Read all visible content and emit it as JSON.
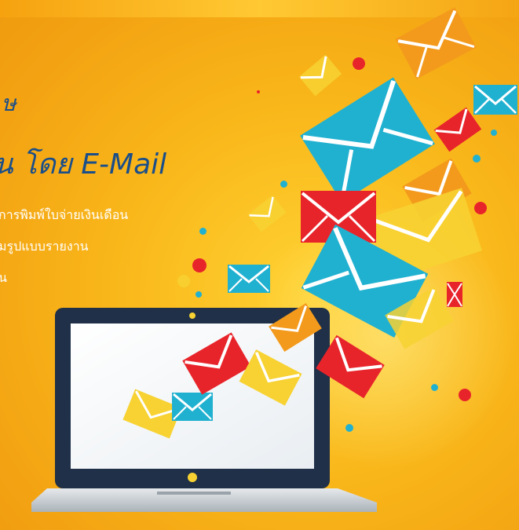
{
  "banner": {
    "title_line1": "ษ",
    "title_line2": "น โดย E-Mail",
    "description_lines": [
      "การพิมพ์ใบจ่ายเงินเดือน",
      "มรูปแบบรายงาน",
      "น"
    ]
  },
  "colors": {
    "background": "#f9b71a",
    "title": "#1a4e8a",
    "envelope_blue": "#21b1d0",
    "envelope_red": "#e8242b",
    "envelope_orange": "#f39a1d",
    "envelope_yellow": "#f7d232",
    "laptop_frame": "#1f3048",
    "laptop_base": "#c9cfd4"
  },
  "icons": [
    "envelope-icon",
    "laptop-icon"
  ]
}
